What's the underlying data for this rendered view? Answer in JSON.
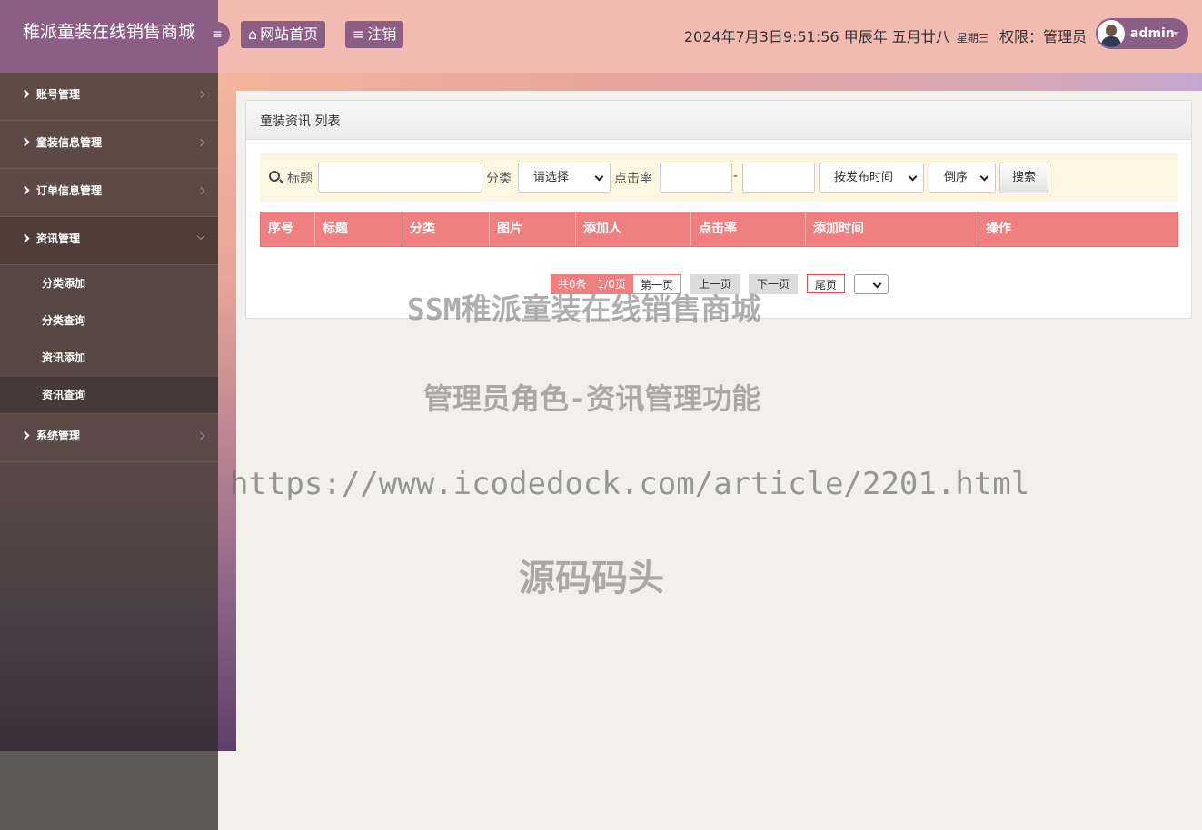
{
  "header": {
    "brand": "稚派童装在线销售商城",
    "home_label": "网站首页",
    "logout_label": "注销",
    "datetime": "2024年7月3日9:51:56 甲辰年 五月廿八",
    "weekday": "星期三",
    "role": "权限：管理员",
    "username": "admin"
  },
  "sidebar": {
    "items": [
      {
        "label": "账号管理"
      },
      {
        "label": "童装信息管理"
      },
      {
        "label": "订单信息管理"
      },
      {
        "label": "资讯管理"
      },
      {
        "label": "系统管理"
      }
    ],
    "sub_items": [
      {
        "label": "分类添加"
      },
      {
        "label": "分类查询"
      },
      {
        "label": "资讯添加"
      },
      {
        "label": "资讯查询"
      }
    ]
  },
  "panel": {
    "title": "童装资讯 列表",
    "search": {
      "title_label": "标题",
      "category_label": "分类",
      "category_value": "请选择",
      "clicks_label": "点击率",
      "dash": "-",
      "sort_value": "按发布时间",
      "order_value": "倒序",
      "search_button": "搜索"
    },
    "table": {
      "columns": [
        "序号",
        "标题",
        "分类",
        "图片",
        "添加人",
        "点击率",
        "添加时间",
        "操作"
      ]
    },
    "pager": {
      "total": "共0条　1/0页",
      "first": "第一页",
      "prev": "上一页",
      "next": "下一页",
      "last": "尾页"
    }
  },
  "watermark": {
    "line1": "SSM稚派童装在线销售商城",
    "line2": "管理员角色-资讯管理功能",
    "line3": "https://www.icodedock.com/article/2201.html",
    "line4": "源码码头"
  },
  "colors": {
    "header": "#f1bbb2",
    "brand": "#8c5e86",
    "table_head": "#f08080",
    "search_bg": "#fdf7e2"
  }
}
